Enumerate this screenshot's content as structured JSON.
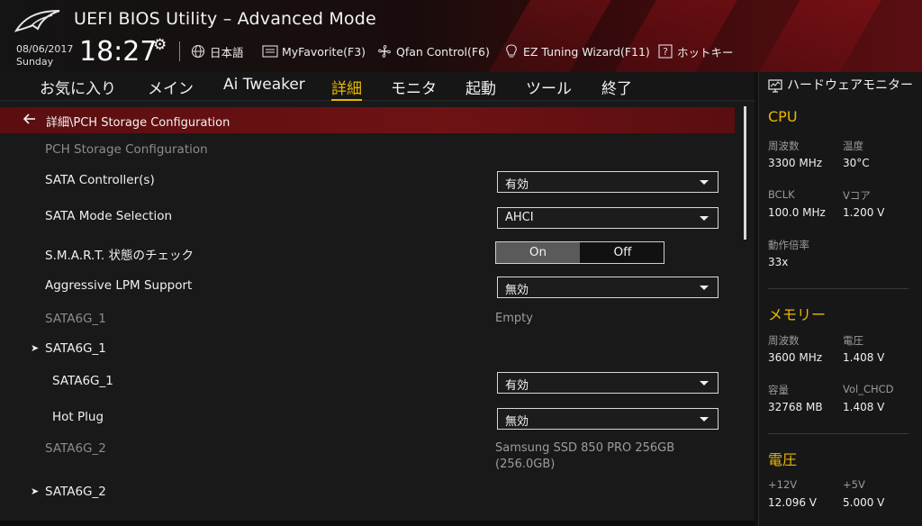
{
  "header": {
    "title": "UEFI BIOS Utility – Advanced Mode",
    "date": "08/06/2017",
    "day": "Sunday",
    "time": "18:27",
    "toolbar": [
      {
        "label": "日本語",
        "icon": "globe-icon"
      },
      {
        "label": "MyFavorite(F3)",
        "icon": "favorite-icon"
      },
      {
        "label": "Qfan Control(F6)",
        "icon": "fan-icon"
      },
      {
        "label": "EZ Tuning Wizard(F11)",
        "icon": "bulb-icon"
      },
      {
        "label": "ホットキー",
        "icon": "help-icon"
      }
    ]
  },
  "menu": [
    {
      "label": "お気に入り"
    },
    {
      "label": "メイン"
    },
    {
      "label": "Ai Tweaker"
    },
    {
      "label": "詳細",
      "active": true
    },
    {
      "label": "モニタ"
    },
    {
      "label": "起動"
    },
    {
      "label": "ツール"
    },
    {
      "label": "終了"
    }
  ],
  "main": {
    "breadcrumb": "詳細\\PCH Storage Configuration",
    "section_title": "PCH Storage Configuration",
    "sata_controller": {
      "label": "SATA Controller(s)",
      "value": "有効"
    },
    "sata_mode": {
      "label": "SATA Mode Selection",
      "value": "AHCI"
    },
    "smart": {
      "label": "S.M.A.R.T. 状態のチェック",
      "on": "On",
      "off": "Off",
      "selected": "On"
    },
    "aggressive_lpm": {
      "label": "Aggressive LPM Support",
      "value": "無効"
    },
    "sata6g_1_status": {
      "label": "SATA6G_1",
      "value": "Empty"
    },
    "sata6g_1_sub": {
      "label": "SATA6G_1"
    },
    "sata6g_1_port": {
      "label": "SATA6G_1",
      "value": "有効"
    },
    "hot_plug": {
      "label": "Hot Plug",
      "value": "無効"
    },
    "sata6g_2_status": {
      "label": "SATA6G_2",
      "value_line1": "Samsung SSD 850 PRO 256GB",
      "value_line2": "(256.0GB)"
    },
    "sata6g_2_sub": {
      "label": "SATA6G_2"
    }
  },
  "hw_monitor": {
    "title": "ハードウェアモニター",
    "cpu": {
      "heading": "CPU",
      "freq_label": "周波数",
      "freq": "3300 MHz",
      "temp_label": "温度",
      "temp": "30°C",
      "bclk_label": "BCLK",
      "bclk": "100.0 MHz",
      "vcore_label": "Vコア",
      "vcore": "1.200 V",
      "ratio_label": "動作倍率",
      "ratio": "33x"
    },
    "memory": {
      "heading": "メモリー",
      "freq_label": "周波数",
      "freq": "3600 MHz",
      "volt_label": "電圧",
      "volt": "1.408 V",
      "cap_label": "容量",
      "cap": "32768 MB",
      "vol_chcd_label": "Vol_CHCD",
      "vol_chcd": "1.408 V"
    },
    "voltage": {
      "heading": "電圧",
      "v12_label": "+12V",
      "v12": "12.096 V",
      "v5_label": "+5V",
      "v5": "5.000 V"
    }
  },
  "colors": {
    "accent": "#e8b800",
    "brand_red": "#6e1214",
    "background": "#191919"
  }
}
